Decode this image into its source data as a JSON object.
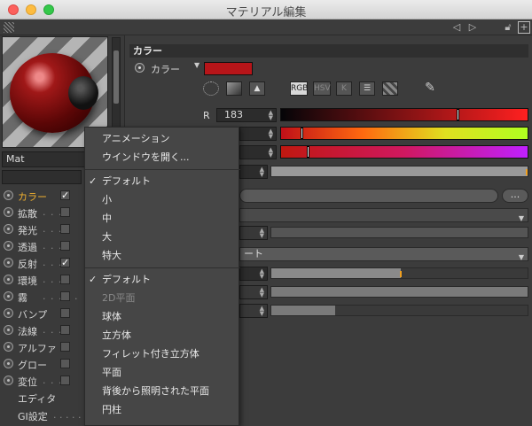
{
  "window": {
    "title": "マテリアル編集"
  },
  "toolbar": {
    "icons": [
      "grip-icon",
      "back-arrow-icon",
      "forward-arrow-icon",
      "lock-icon",
      "new-window-icon"
    ]
  },
  "material": {
    "name": "Mat"
  },
  "channels": [
    {
      "label": "カラー",
      "dots": "",
      "checked": true,
      "active": true
    },
    {
      "label": "拡散",
      "dots": ". . .",
      "checked": false
    },
    {
      "label": "発光",
      "dots": ". . .",
      "checked": false
    },
    {
      "label": "透過",
      "dots": ". . .",
      "checked": false
    },
    {
      "label": "反射",
      "dots": ". . .",
      "checked": true
    },
    {
      "label": "環境",
      "dots": ". . .",
      "checked": false
    },
    {
      "label": "霧",
      "dots": ". . . . .",
      "checked": false
    },
    {
      "label": "バンプ",
      "dots": "",
      "checked": false
    },
    {
      "label": "法線",
      "dots": ". . .",
      "checked": false
    },
    {
      "label": "アルファ",
      "dots": "",
      "checked": false
    },
    {
      "label": "グロー",
      "dots": "",
      "checked": false
    },
    {
      "label": "変位",
      "dots": ". . .",
      "checked": false
    }
  ],
  "extra_items": {
    "editor": "エディタ",
    "gi": "GI設定",
    "gi_dots": ". . . . . ."
  },
  "color_section": {
    "header": "カラー",
    "color_label": "カラー",
    "swatch_color": "#b71519",
    "modes": [
      "RGB",
      "HSV",
      "K"
    ],
    "r_label": "R",
    "r_value": "183"
  },
  "long_dropdown": {
    "suffix": "ート"
  },
  "ellipsis": "...",
  "context_menu": {
    "items_top": [
      "アニメーション",
      "ウインドウを開く..."
    ],
    "size_items": [
      {
        "label": "デフォルト",
        "checked": true
      },
      {
        "label": "小",
        "checked": false
      },
      {
        "label": "中",
        "checked": false
      },
      {
        "label": "大",
        "checked": false
      },
      {
        "label": "特大",
        "checked": false
      }
    ],
    "shape_items": [
      {
        "label": "デフォルト",
        "checked": true,
        "disabled": false
      },
      {
        "label": "2D平面",
        "checked": false,
        "disabled": true
      },
      {
        "label": "球体",
        "checked": false,
        "disabled": false
      },
      {
        "label": "立方体",
        "checked": false,
        "disabled": false
      },
      {
        "label": "フィレット付き立方体",
        "checked": false,
        "disabled": false
      },
      {
        "label": "平面",
        "checked": false,
        "disabled": false
      },
      {
        "label": "背後から照明された平面",
        "checked": false,
        "disabled": false
      },
      {
        "label": "円柱",
        "checked": false,
        "disabled": false
      }
    ]
  }
}
